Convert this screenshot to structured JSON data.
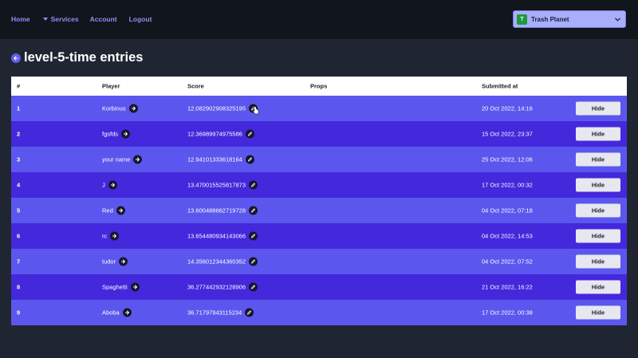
{
  "nav": {
    "home": "Home",
    "services": "Services",
    "account": "Account",
    "logout": "Logout"
  },
  "team": {
    "initial": "T",
    "name": "Trash Planet"
  },
  "page": {
    "title": "level-5-time entries"
  },
  "table": {
    "headers": {
      "num": "#",
      "player": "Player",
      "score": "Score",
      "props": "Props",
      "submitted": "Submitted at"
    },
    "hide_label": "Hide",
    "rows": [
      {
        "num": "1",
        "player": "Korbinus",
        "score": "12.082902908325195",
        "props": "",
        "submitted": "20 Oct 2022, 14:16"
      },
      {
        "num": "2",
        "player": "fgsfds",
        "score": "12.36989974975586",
        "props": "",
        "submitted": "15 Oct 2022, 23:37"
      },
      {
        "num": "3",
        "player": "your name",
        "score": "12.94101333618164",
        "props": "",
        "submitted": "25 Oct 2022, 12:06"
      },
      {
        "num": "4",
        "player": "J",
        "score": "13.470015525817873",
        "props": "",
        "submitted": "17 Oct 2022, 00:32"
      },
      {
        "num": "5",
        "player": "Red",
        "score": "13.600488662719728",
        "props": "",
        "submitted": "04 Oct 2022, 07:18"
      },
      {
        "num": "6",
        "player": "rc",
        "score": "13.654480934143066",
        "props": "",
        "submitted": "04 Oct 2022, 14:53"
      },
      {
        "num": "7",
        "player": "tudor",
        "score": "14.356012344360352",
        "props": "",
        "submitted": "04 Oct 2022, 07:52"
      },
      {
        "num": "8",
        "player": "Spaghetti",
        "score": "36.277442932128906",
        "props": "",
        "submitted": "21 Oct 2022, 16:22"
      },
      {
        "num": "9",
        "player": "Aboba",
        "score": "36.71797943115234",
        "props": "",
        "submitted": "17 Oct 2022, 00:38"
      }
    ]
  },
  "colors": {
    "background": "#202631",
    "topbar": "#11151c",
    "nav_link": "#8d8ff2",
    "row_light": "#5b57ee",
    "row_dark": "#4428dc",
    "team_select": "#a9aefb",
    "team_avatar": "#1e9a3d"
  }
}
